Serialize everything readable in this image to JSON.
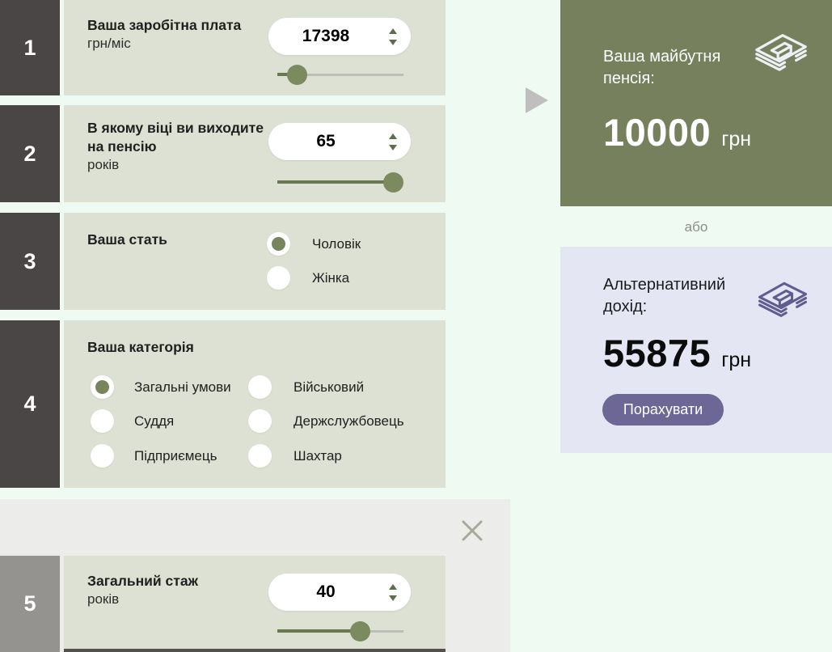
{
  "colors": {
    "accent_olive": "#78855c",
    "panel_green_bg": "#76805c",
    "panel_lavender_bg": "#e4e7f3",
    "button_purple": "#6d6795",
    "section_panel_bg": "#dce1d3",
    "numbox_dark": "#4a4645"
  },
  "sections": {
    "salary": {
      "number": "1",
      "title": "Ваша заробітна плата",
      "unit": "грн/міс",
      "value": "17398",
      "slider_fill": "16%"
    },
    "age": {
      "number": "2",
      "title": "В якому віці ви виходите на пенсію",
      "unit": "років",
      "value": "65",
      "slider_fill": "92%"
    },
    "gender": {
      "number": "3",
      "title": "Ваша стать",
      "options": [
        {
          "label": "Чоловік",
          "checked": true
        },
        {
          "label": "Жінка",
          "checked": false
        }
      ]
    },
    "category": {
      "number": "4",
      "title": "Ваша категорія",
      "options": [
        {
          "label": "Загальні умови",
          "checked": true
        },
        {
          "label": "Військовий",
          "checked": false
        },
        {
          "label": "Суддя",
          "checked": false
        },
        {
          "label": "Держслужбовець",
          "checked": false
        },
        {
          "label": "Підприємець",
          "checked": false
        },
        {
          "label": "Шахтар",
          "checked": false
        }
      ]
    },
    "experience": {
      "number": "5",
      "title": "Загальний стаж",
      "unit": "років",
      "value": "40",
      "slider_fill": "66%"
    }
  },
  "results": {
    "pension": {
      "title": "Ваша майбутня пенсія:",
      "value": "10000",
      "currency": "грн"
    },
    "or_text": "або",
    "alternative": {
      "title": "Альтернативний дохід:",
      "value": "55875",
      "currency": "грн",
      "button_label": "Порахувати"
    }
  }
}
